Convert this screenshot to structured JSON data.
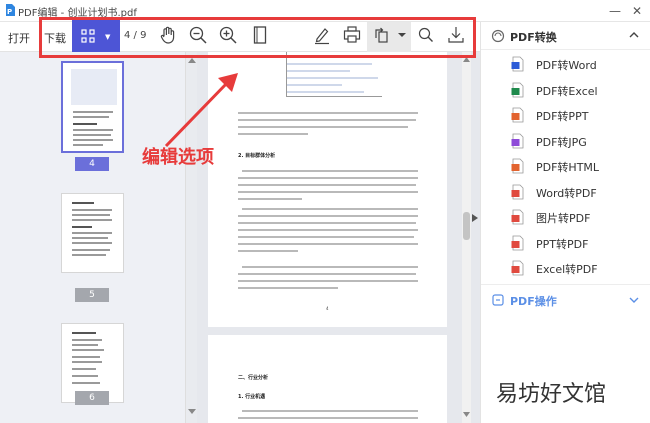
{
  "window": {
    "title": "PDF编辑 - 创业计划书.pdf"
  },
  "toolbar": {
    "open_label": "打开",
    "download_label": "下载",
    "page_indicator": "4 / 9"
  },
  "annotation": "编辑选项",
  "right_panel": {
    "convert_header": "PDF转换",
    "items": [
      {
        "label": "PDF转Word",
        "color": "#2b5bd7"
      },
      {
        "label": "PDF转Excel",
        "color": "#1f8a4c"
      },
      {
        "label": "PDF转PPT",
        "color": "#e2632f"
      },
      {
        "label": "PDF转JPG",
        "color": "#8e4bd8"
      },
      {
        "label": "PDF转HTML",
        "color": "#e2632f"
      },
      {
        "label": "Word转PDF",
        "color": "#e04a3f"
      },
      {
        "label": "图片转PDF",
        "color": "#e04a3f"
      },
      {
        "label": "PPT转PDF",
        "color": "#e04a3f"
      },
      {
        "label": "Excel转PDF",
        "color": "#e04a3f"
      }
    ],
    "ops_header": "PDF操作"
  },
  "thumbnails": [
    {
      "page": "4",
      "selected": true
    },
    {
      "page": "5",
      "selected": false
    },
    {
      "page": "6",
      "selected": false
    }
  ],
  "document": {
    "section1_title": "2. 目标群体分析",
    "section2_title": "二、行业分析",
    "subsection_title": "1. 行业机遇",
    "page_number": "4"
  },
  "watermark": "易坊好文馆",
  "colors": {
    "accent": "#4d55d6",
    "highlight": "#e73b3b",
    "link": "#5b8fe6"
  }
}
